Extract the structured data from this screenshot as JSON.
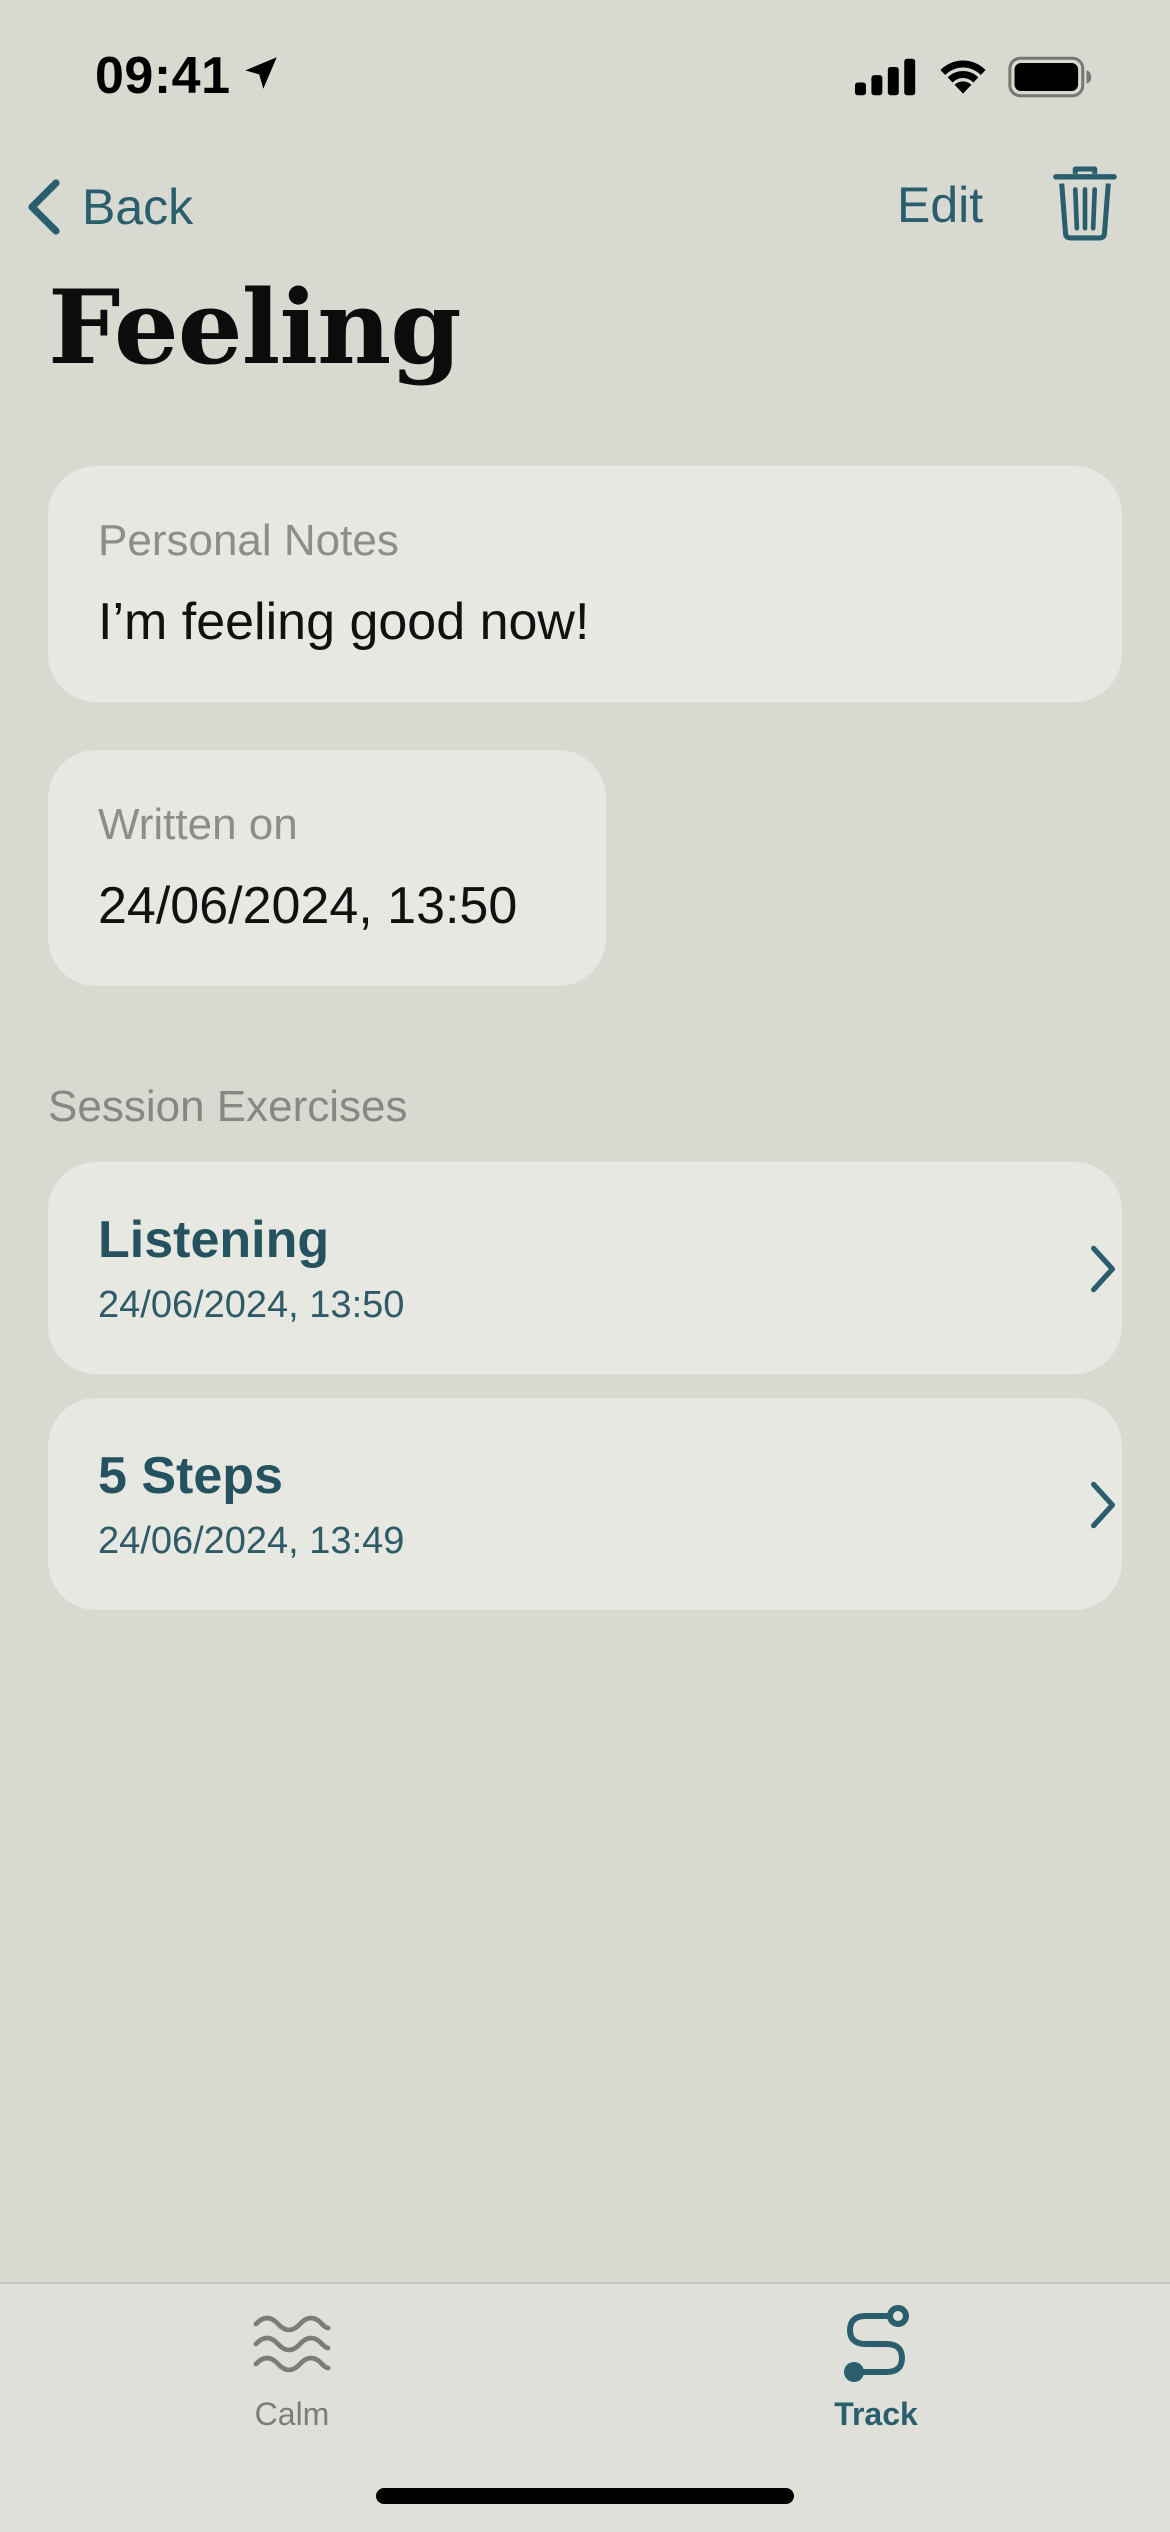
{
  "status_bar": {
    "time": "09:41"
  },
  "nav": {
    "back_label": "Back",
    "edit_label": "Edit"
  },
  "page": {
    "title": "Feeling"
  },
  "notes_card": {
    "label": "Personal Notes",
    "value": "I’m feeling good now!"
  },
  "written_card": {
    "label": "Written on",
    "value": "24/06/2024, 13:50"
  },
  "exercises": {
    "header": "Session Exercises",
    "items": [
      {
        "name": "Listening",
        "date": "24/06/2024, 13:50"
      },
      {
        "name": "5 Steps",
        "date": "24/06/2024, 13:49"
      }
    ]
  },
  "tab_bar": {
    "tabs": [
      {
        "label": "Calm",
        "icon": "waves-icon",
        "selected": false
      },
      {
        "label": "Track",
        "icon": "path-icon",
        "selected": true
      }
    ]
  },
  "colors": {
    "background": "#d8d9d1",
    "card": "#e7e8e2",
    "accent": "#2a5e6c",
    "muted_text": "#8c8e89"
  }
}
